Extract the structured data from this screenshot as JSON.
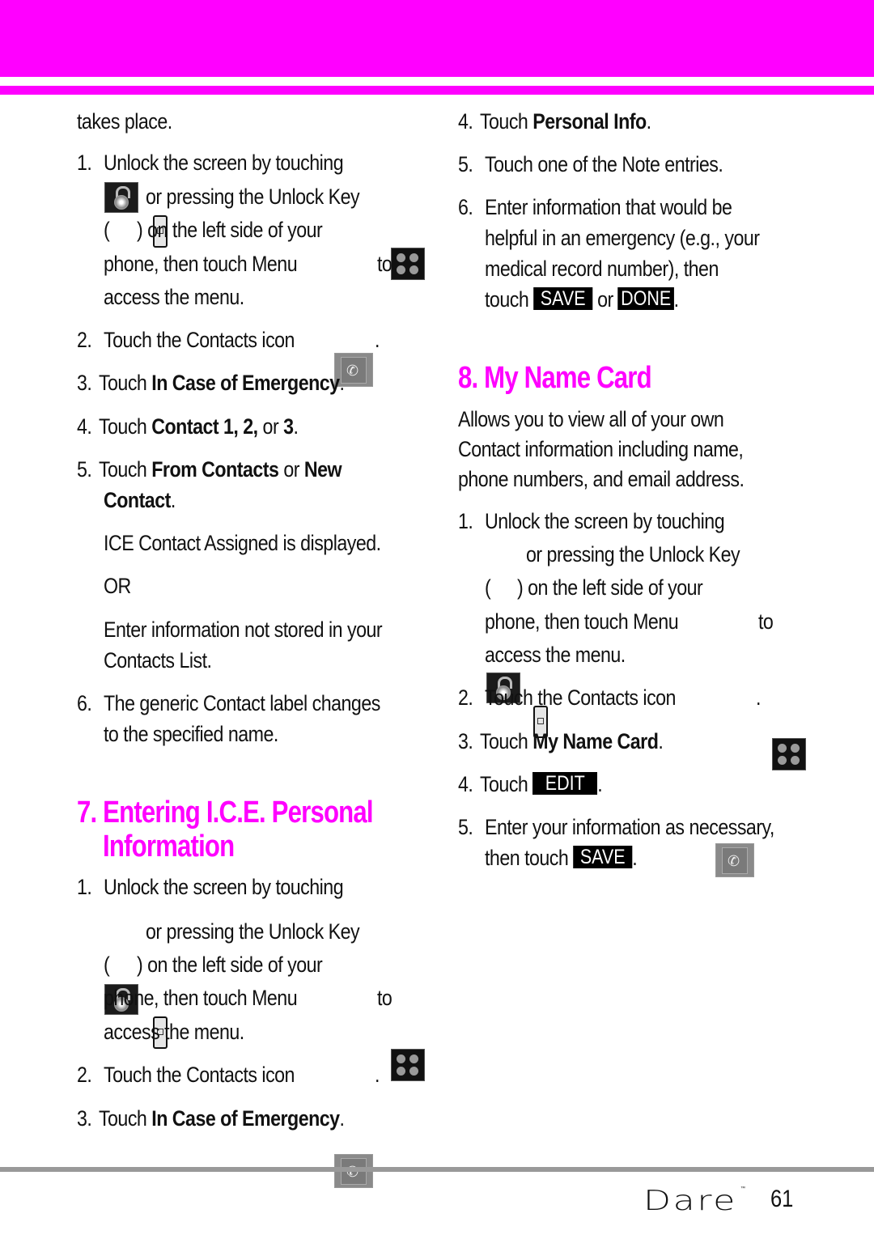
{
  "colors": {
    "accent": "#ff00ff",
    "rule": "#999999",
    "text": "#111111"
  },
  "left": {
    "continuation": "takes place.",
    "steps_a": {
      "s1": {
        "num": "1.",
        "l1": "Unlock the screen by touching",
        "l2": "or pressing the Unlock Key",
        "l3a": "(",
        "l3b": ") on the left side of your",
        "l4a": "phone, then touch Menu",
        "l4b": "to",
        "l5": "access the menu."
      },
      "s2": {
        "num": "2.",
        "text": "Touch the Contacts icon",
        "end": "."
      },
      "s3": {
        "num": "3.",
        "pre": "Touch ",
        "bold": "In Case of Emergency",
        "end": "."
      },
      "s4": {
        "num": "4.",
        "pre": "Touch ",
        "bold1": "Contact 1, 2,",
        "mid": " or ",
        "bold2": "3",
        "end": "."
      },
      "s5": {
        "num": "5.",
        "pre": "Touch ",
        "bold1": "From Contacts",
        "mid": " or ",
        "bold2": "New",
        "bold3": "Contact",
        "end": "."
      },
      "s5_note1": "ICE Contact Assigned is displayed.",
      "s5_or": "OR",
      "s5_note2a": "Enter information not stored in your",
      "s5_note2b": "Contacts List.",
      "s6": {
        "num": "6.",
        "l1": "The generic Contact label changes",
        "l2": "to the specified name."
      }
    },
    "section7": {
      "title_l1": "7. Entering I.C.E. Personal",
      "title_l2": "Information"
    },
    "steps_b": {
      "s1": {
        "num": "1.",
        "l1": "Unlock the screen by touching",
        "l2": "or pressing the Unlock Key",
        "l3a": "(",
        "l3b": ") on the left side of your",
        "l4a": "phone, then touch Menu",
        "l4b": "to",
        "l5": "access the menu."
      },
      "s2": {
        "num": "2.",
        "text": "Touch the Contacts icon",
        "end": "."
      },
      "s3": {
        "num": "3.",
        "pre": "Touch ",
        "bold": "In Case of Emergency",
        "end": "."
      }
    }
  },
  "right": {
    "steps_a": {
      "s4": {
        "num": "4.",
        "pre": "Touch ",
        "bold": "Personal Info",
        "end": "."
      },
      "s5": {
        "num": "5.",
        "text": "Touch one of the Note entries."
      },
      "s6": {
        "num": "6.",
        "l1": "Enter information that would be",
        "l2": "helpful in an emergency (e.g., your",
        "l3": "medical record number), then",
        "l4a": "touch",
        "key1": "SAVE",
        "mid": "or",
        "key2": "DONE",
        "end": "."
      }
    },
    "section8": {
      "title": "8. My Name Card",
      "desc_l1": "Allows you to view all of your own",
      "desc_l2": "Contact information including name,",
      "desc_l3": "phone numbers, and email address."
    },
    "steps_b": {
      "s1": {
        "num": "1.",
        "l1": "Unlock the screen by touching",
        "l2": "or pressing the Unlock Key",
        "l3a": "(",
        "l3b": ") on the left side of your",
        "l4a": "phone, then touch Menu",
        "l4b": "to",
        "l5": "access the menu."
      },
      "s2": {
        "num": "2.",
        "text": "Touch the Contacts icon",
        "end": "."
      },
      "s3": {
        "num": "3.",
        "pre": "Touch ",
        "bold": "My Name Card",
        "end": "."
      },
      "s4": {
        "num": "4.",
        "pre": "Touch",
        "key": "EDIT",
        "end": "."
      },
      "s5": {
        "num": "5.",
        "l1": "Enter your information as necessary,",
        "l2a": "then touch",
        "key": "SAVE",
        "end": "."
      }
    }
  },
  "footer": {
    "brand": "Dare",
    "tm": "™",
    "page": "61"
  }
}
